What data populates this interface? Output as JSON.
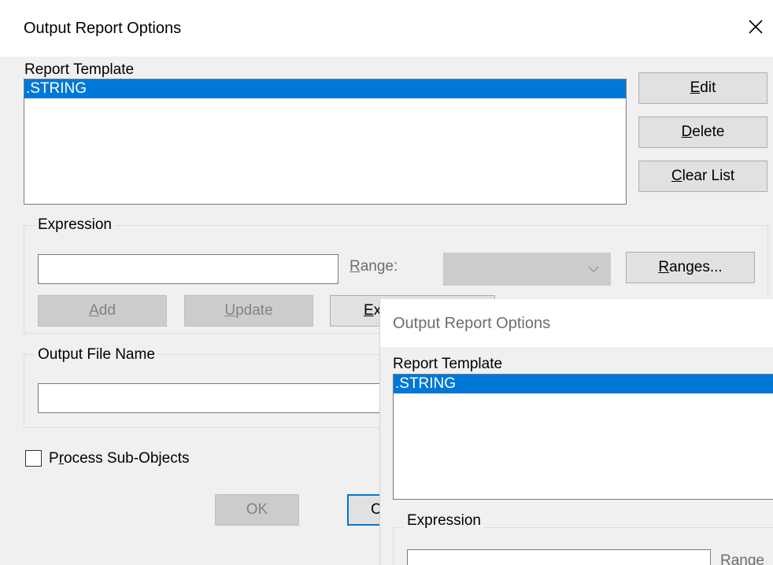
{
  "window": {
    "title": "Output Report Options",
    "close_icon": "close-icon"
  },
  "report_template": {
    "label": "Report Template",
    "items": [
      ".STRING"
    ],
    "selected": ".STRING"
  },
  "side_buttons": {
    "edit": {
      "pre": "",
      "key": "E",
      "post": "dit"
    },
    "delete": {
      "pre": "",
      "key": "D",
      "post": "elete"
    },
    "clear_list": {
      "pre": "",
      "key": "C",
      "post": "lear List"
    }
  },
  "expression": {
    "group_label": "Expression",
    "input_value": "",
    "range_label": {
      "key": "R",
      "post": "ange:"
    },
    "range_value": "",
    "ranges_button": {
      "key": "R",
      "post": "anges..."
    },
    "add_button": {
      "key": "A",
      "post": "dd"
    },
    "update_button": {
      "key": "U",
      "post": "pdate"
    },
    "ex_button_partial": {
      "key": "E",
      "post": "x"
    }
  },
  "output_file": {
    "group_label": "Output File Name",
    "value": ""
  },
  "process_sub_objects": {
    "label_pre": "P",
    "label_key": "r",
    "label_post": "ocess Sub-Objects",
    "checked": false
  },
  "footer": {
    "ok_label": "OK",
    "cancel_partial": "C"
  },
  "overlay_dialog": {
    "title": "Output Report Options",
    "report_template_label": "Report Template",
    "selected_item": ".STRING",
    "expression_label": "Expression",
    "range_partial": "Range"
  },
  "colors": {
    "selection": "#0078d7",
    "disabled_bg": "#cccccc",
    "window_bg": "#f0f0f0"
  }
}
